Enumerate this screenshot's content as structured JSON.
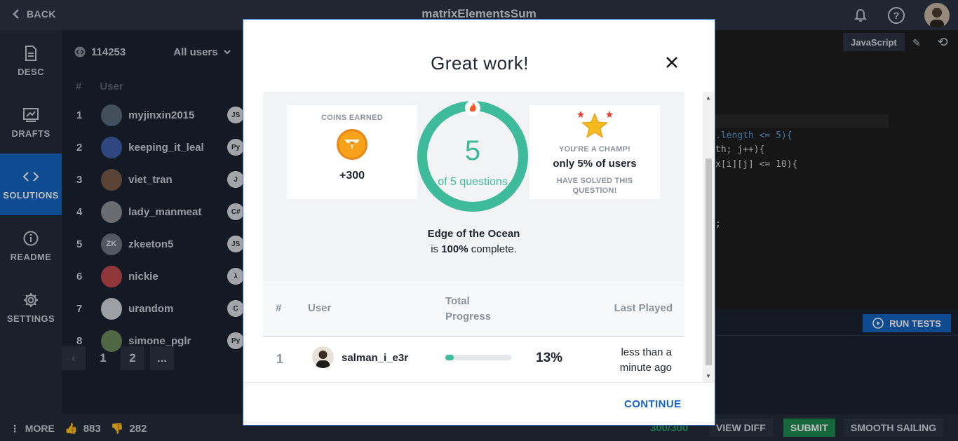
{
  "topbar": {
    "back_label": "BACK",
    "title": "matrixElementsSum",
    "icons": [
      "bell-icon",
      "help-icon",
      "avatar"
    ]
  },
  "nav": {
    "items": [
      {
        "label": "DESC",
        "icon": "document-icon"
      },
      {
        "label": "DRAFTS",
        "icon": "drafts-icon"
      },
      {
        "label": "SOLUTIONS",
        "icon": "code-icon",
        "active": true
      },
      {
        "label": "README",
        "icon": "info-icon"
      },
      {
        "label": "SETTINGS",
        "icon": "gear-icon"
      }
    ]
  },
  "solutions": {
    "count": "114253",
    "filter": "All users",
    "col_rank": "#",
    "col_user": "User",
    "rows": [
      {
        "rank": "1",
        "user": "myjinxin2015",
        "lang": "JS",
        "avatar_text": ""
      },
      {
        "rank": "2",
        "user": "keeping_it_leal",
        "lang": "Py",
        "avatar_text": ""
      },
      {
        "rank": "3",
        "user": "viet_tran",
        "lang": "J",
        "avatar_text": ""
      },
      {
        "rank": "4",
        "user": "lady_manmeat",
        "lang": "C#",
        "avatar_text": ""
      },
      {
        "rank": "5",
        "user": "zkeeton5",
        "lang": "JS",
        "avatar_text": "ZK"
      },
      {
        "rank": "6",
        "user": "nickie",
        "lang": "λ",
        "avatar_text": ""
      },
      {
        "rank": "7",
        "user": "urandom",
        "lang": "C",
        "avatar_text": ""
      },
      {
        "rank": "8",
        "user": "simone_pglr",
        "lang": "Py",
        "avatar_text": ""
      }
    ],
    "pager": {
      "prev": "‹",
      "pages": [
        "1",
        "2"
      ],
      "ellipsis": "..."
    }
  },
  "editor": {
    "language": "JavaScript",
    "code_lines": [
      {
        "text": ".length <= 5){",
        "color": "#569cd6"
      },
      {
        "text": "th; j++){",
        "color": "#d4d4d4"
      },
      {
        "text": "x[i][j] <= 10){",
        "color": "#d4d4d4"
      },
      {
        "text": ";",
        "color": "#d4d4d4"
      }
    ],
    "run_tests": "RUN TESTS"
  },
  "bottombar": {
    "more": "MORE",
    "upvotes": "883",
    "downvotes": "282",
    "score": "300/300",
    "view_diff": "VIEW DIFF",
    "submit": "SUBMIT",
    "smooth": "SMOOTH SAILING"
  },
  "modal": {
    "title": "Great work!",
    "coins_label": "COINS EARNED",
    "coins_value": "+300",
    "questions_done": "5",
    "questions_total_text": "of 5 questions",
    "progress_fraction": 1.0,
    "champ_line1": "YOU'RE A CHAMP!",
    "champ_line2": "only 5% of users",
    "champ_line3a": "HAVE SOLVED THIS",
    "champ_line3b": "QUESTION!",
    "topic_name": "Edge of the Ocean",
    "topic_is": "is",
    "topic_pct": "100%",
    "topic_complete": "complete.",
    "table": {
      "col_rank": "#",
      "col_user": "User",
      "col_progress_1": "Total",
      "col_progress_2": "Progress",
      "col_last": "Last Played",
      "row": {
        "rank": "1",
        "user": "salman_i_e3r",
        "progress": 0.13,
        "progress_text": "13%",
        "last_played_1": "less than a",
        "last_played_2": "minute ago"
      }
    },
    "continue": "CONTINUE"
  },
  "colors": {
    "accent": "#1565c0",
    "ring": "#3dbb9b",
    "coin": "#f6a21a",
    "submit": "#1f8a52"
  }
}
